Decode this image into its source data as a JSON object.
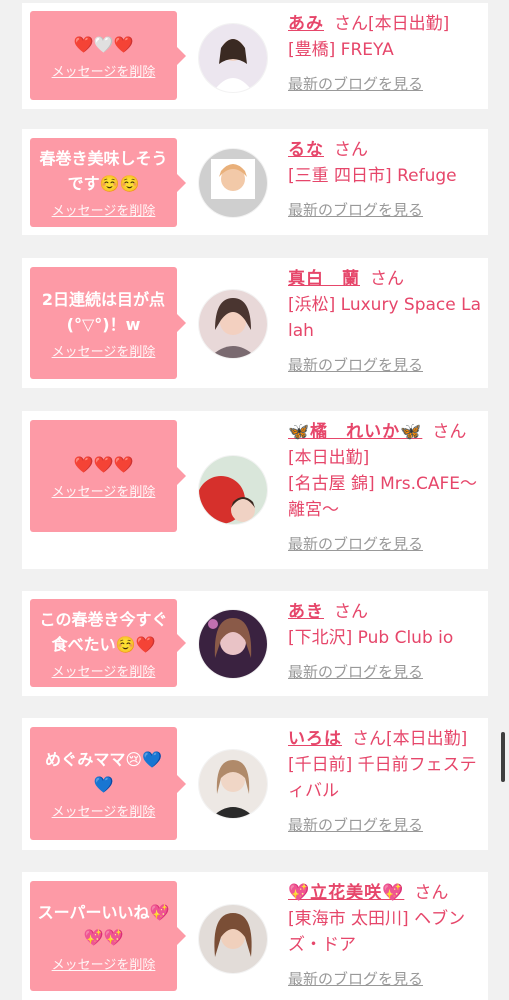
{
  "colors": {
    "bubble": "#fd9aa6",
    "name_text": "#e6466a",
    "blog_link": "#999999",
    "background": "#f1f1f1"
  },
  "cards": [
    {
      "message": "❤️🤍❤️",
      "delete_label": "メッセージを削除",
      "name": "あみ",
      "san": "さん",
      "status_inline": "[本日出勤]",
      "detail_lines": [
        "[豊橋] FREYA"
      ],
      "blog_label": "最新のブログを見る"
    },
    {
      "message": "春巻き美味しそうです☺️☺️",
      "delete_label": "メッセージを削除",
      "name": "るな",
      "san": "さん",
      "status_inline": "",
      "detail_lines": [
        "[三重 四日市] Refuge"
      ],
      "blog_label": "最新のブログを見る"
    },
    {
      "message": "2日連続は目が点(°▽°)！w",
      "delete_label": "メッセージを削除",
      "name": "真白　蘭",
      "san": "さん",
      "status_inline": "",
      "detail_lines": [
        "[浜松] Luxury Space Lalah"
      ],
      "blog_label": "最新のブログを見る"
    },
    {
      "message": "❤️❤️❤️",
      "delete_label": "メッセージを削除",
      "name": "🦋橘　れいか🦋",
      "san": "さん",
      "status_inline": "",
      "detail_lines": [
        "[本日出勤]",
        "[名古屋 錦] Mrs.CAFE～離宮～"
      ],
      "blog_label": "最新のブログを見る"
    },
    {
      "message": "この春巻き今すぐ食べたい☺️❤️",
      "delete_label": "メッセージを削除",
      "name": "あき",
      "san": "さん",
      "status_inline": "",
      "detail_lines": [
        "[下北沢] Pub Club io"
      ],
      "blog_label": "最新のブログを見る"
    },
    {
      "message": "めぐみママ😢💙💙",
      "delete_label": "メッセージを削除",
      "name": "いろは",
      "san": "さん",
      "status_inline": "[本日出勤]",
      "detail_lines": [
        "[千日前] 千日前フェスティバル"
      ],
      "blog_label": "最新のブログを見る"
    },
    {
      "message": "スーパーいいね💖💖💖",
      "delete_label": "メッセージを削除",
      "name": "💖立花美咲💖",
      "san": "さん",
      "status_inline": "",
      "detail_lines": [
        "[東海市 太田川] ヘブンズ・ドア"
      ],
      "blog_label": "最新のブログを見る"
    }
  ]
}
